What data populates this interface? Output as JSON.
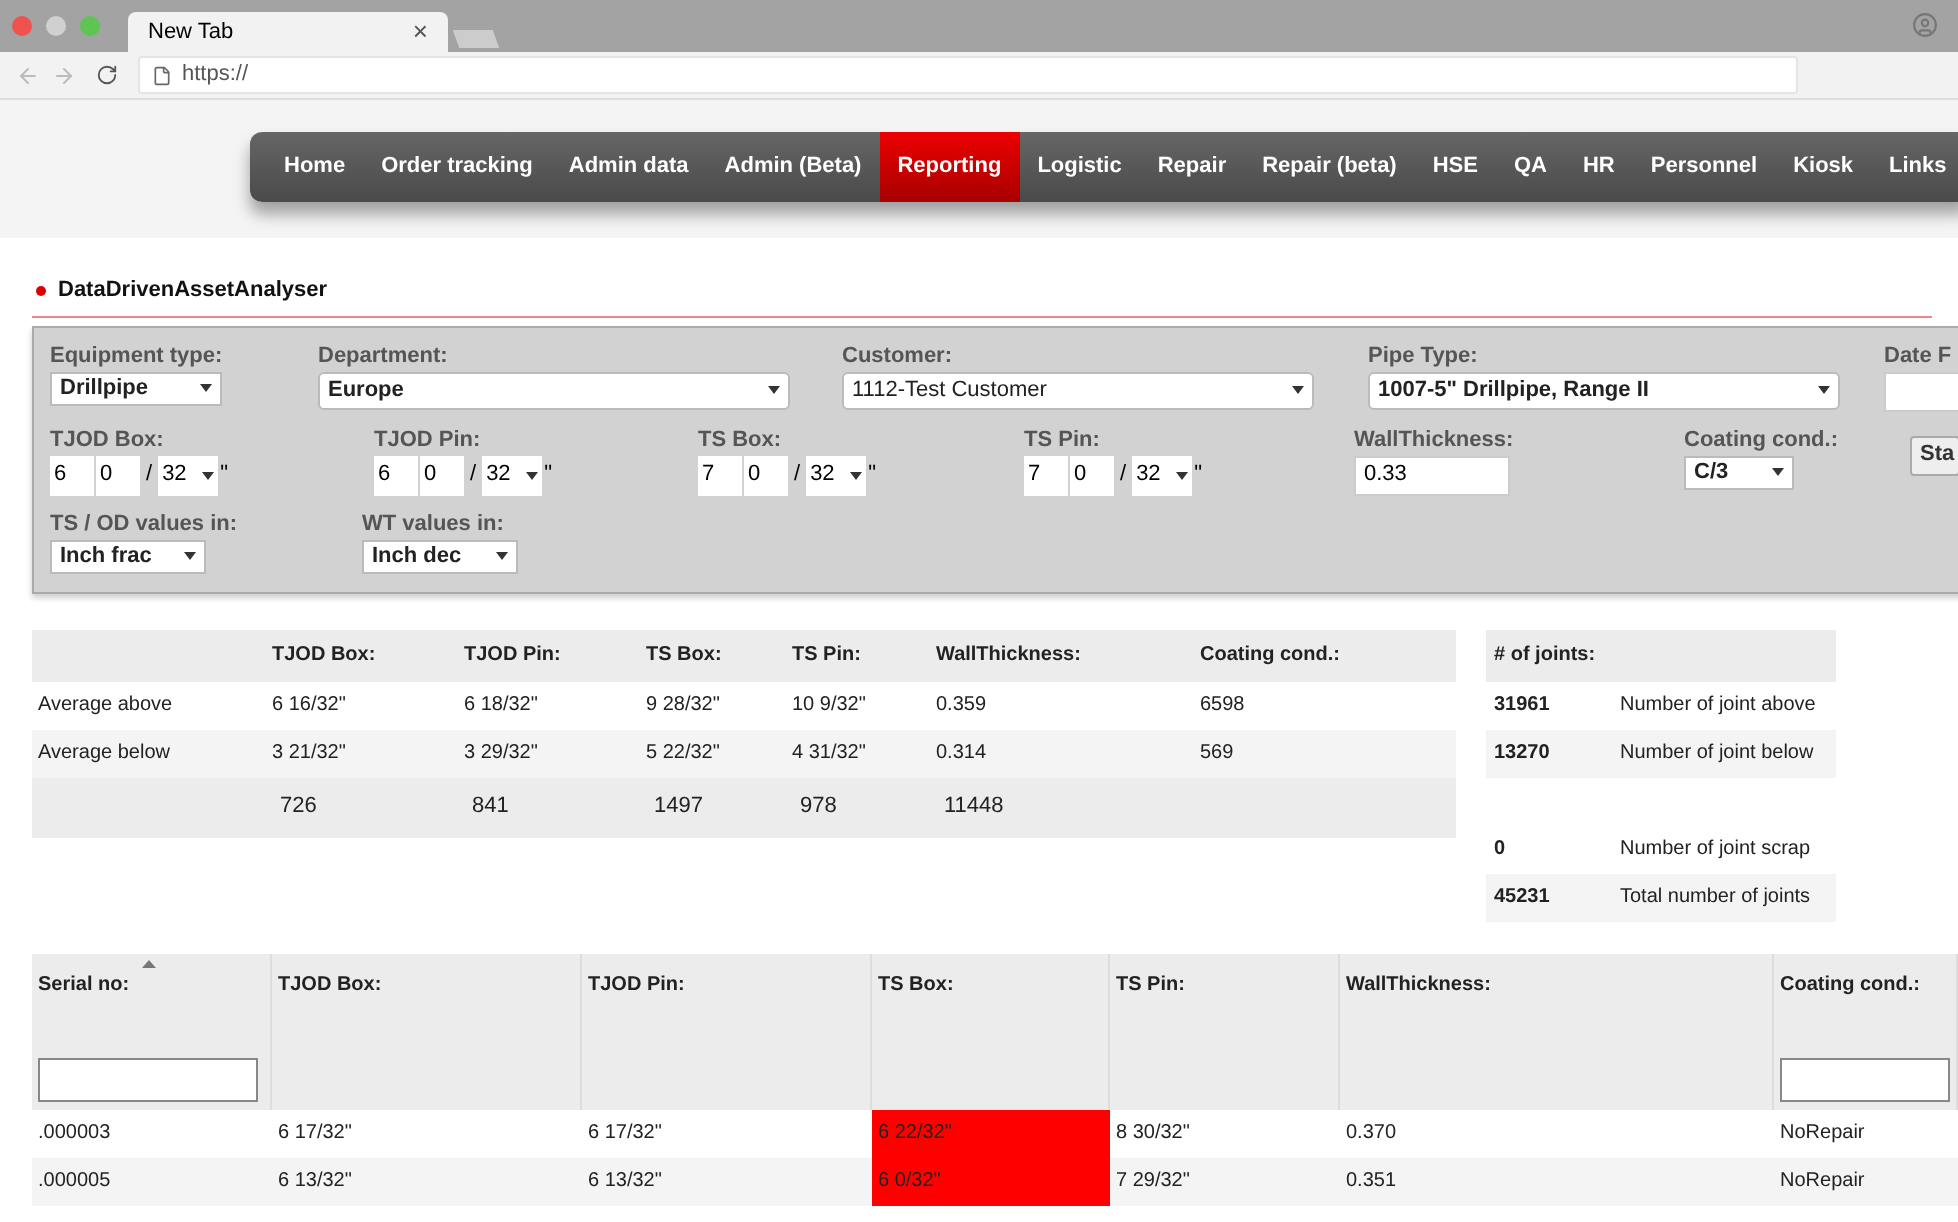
{
  "browser": {
    "tab_title": "New Tab",
    "tab_close": "×",
    "url": "https://"
  },
  "nav": [
    {
      "label": "Home",
      "selected": false
    },
    {
      "label": "Order tracking",
      "selected": false
    },
    {
      "label": "Admin data",
      "selected": false
    },
    {
      "label": "Admin (Beta)",
      "selected": false
    },
    {
      "label": "Reporting",
      "selected": true
    },
    {
      "label": "Logistic",
      "selected": false
    },
    {
      "label": "Repair",
      "selected": false
    },
    {
      "label": "Repair (beta)",
      "selected": false
    },
    {
      "label": "HSE",
      "selected": false
    },
    {
      "label": "QA",
      "selected": false
    },
    {
      "label": "HR",
      "selected": false
    },
    {
      "label": "Personnel",
      "selected": false
    },
    {
      "label": "Kiosk",
      "selected": false
    },
    {
      "label": "Links",
      "selected": false
    }
  ],
  "panel_title": "DataDrivenAssetAnalyser",
  "filters": {
    "row1": [
      {
        "kind": "select",
        "label": "Equipment type:",
        "value": "Drillpipe",
        "bold": true
      },
      {
        "kind": "select",
        "label": "Department:",
        "value": "Europe",
        "bold": true
      },
      {
        "kind": "select",
        "label": "Customer:",
        "value": "1112-Test Customer",
        "bold": false
      },
      {
        "kind": "select",
        "label": "Pipe Type:",
        "value": "1007-5\" Drillpipe, Range II",
        "bold": true
      },
      {
        "kind": "text",
        "label": "Date F"
      }
    ],
    "row2": [
      {
        "kind": "fraction",
        "label": "TJOD Box:",
        "whole": "6",
        "numerator": "0",
        "separator": "/",
        "denominator": "32",
        "unit": "\""
      },
      {
        "kind": "fraction",
        "label": "TJOD Pin:",
        "whole": "6",
        "numerator": "0",
        "separator": "/",
        "denominator": "32",
        "unit": "\""
      },
      {
        "kind": "fraction",
        "label": "TS Box:",
        "whole": "7",
        "numerator": "0",
        "separator": "/",
        "denominator": "32",
        "unit": "\""
      },
      {
        "kind": "fraction",
        "label": "TS Pin:",
        "whole": "7",
        "numerator": "0",
        "separator": "/",
        "denominator": "32",
        "unit": "\""
      },
      {
        "kind": "text",
        "label": "WallThickness:",
        "value": "0.33"
      },
      {
        "kind": "select",
        "label": "Coating cond.:",
        "value": "C/3",
        "bold": true
      },
      {
        "kind": "button",
        "label": "Sta"
      }
    ],
    "row3": [
      {
        "kind": "select",
        "label": "TS / OD values in:",
        "value": "Inch frac",
        "bold": true
      },
      {
        "kind": "select",
        "label": "WT values in:",
        "value": "Inch dec",
        "bold": true
      }
    ]
  },
  "summary": {
    "columns": [
      "TJOD Box:",
      "TJOD Pin:",
      "TS Box:",
      "TS Pin:",
      "WallThickness:",
      "Coating cond.:"
    ],
    "rows": [
      {
        "label": "Average above",
        "values": [
          "6 16/32\"",
          "6 18/32\"",
          "9 28/32\"",
          "10 9/32\"",
          "0.359",
          "6598"
        ]
      },
      {
        "label": "Average below",
        "values": [
          "3 21/32\"",
          "3 29/32\"",
          "5 22/32\"",
          "4 31/32\"",
          "0.314",
          "569"
        ]
      }
    ],
    "totals": [
      "726",
      "841",
      "1497",
      "978",
      "11448"
    ]
  },
  "joints": {
    "header": "# of joints:",
    "groups": [
      [
        {
          "count": "31961",
          "label": "Number of joint above"
        },
        {
          "count": "13270",
          "label": "Number of joint below"
        }
      ],
      [
        {
          "count": "0",
          "label": "Number of joint scrap"
        },
        {
          "count": "45231",
          "label": "Total number of joints"
        }
      ]
    ]
  },
  "grid": {
    "columns": [
      {
        "label": "Serial no:",
        "kind": "filterable",
        "sorted": true
      },
      {
        "label": "TJOD Box:",
        "kind": "plain",
        "sorted": false
      },
      {
        "label": "TJOD Pin:",
        "kind": "plain",
        "sorted": false
      },
      {
        "label": "TS Box:",
        "kind": "plain",
        "sorted": false
      },
      {
        "label": "TS Pin:",
        "kind": "plain",
        "sorted": false
      },
      {
        "label": "WallThickness:",
        "kind": "plain",
        "sorted": false
      },
      {
        "label": "Coating cond.:",
        "kind": "filterable",
        "sorted": false
      }
    ],
    "rows": [
      {
        "cells": [
          {
            "text": ".000003",
            "flagged": false
          },
          {
            "text": "6 17/32\"",
            "flagged": false
          },
          {
            "text": "6 17/32\"",
            "flagged": false
          },
          {
            "text": "6 22/32\"",
            "flagged": true
          },
          {
            "text": "8 30/32\"",
            "flagged": false
          },
          {
            "text": "0.370",
            "flagged": false
          },
          {
            "text": "NoRepair",
            "flagged": false
          }
        ]
      },
      {
        "cells": [
          {
            "text": ".000005",
            "flagged": false
          },
          {
            "text": "6 13/32\"",
            "flagged": false
          },
          {
            "text": "6 13/32\"",
            "flagged": false
          },
          {
            "text": "6 0/32\"",
            "flagged": true
          },
          {
            "text": "7 29/32\"",
            "flagged": false
          },
          {
            "text": "0.351",
            "flagged": false
          },
          {
            "text": "NoRepair",
            "flagged": false
          }
        ]
      }
    ]
  }
}
